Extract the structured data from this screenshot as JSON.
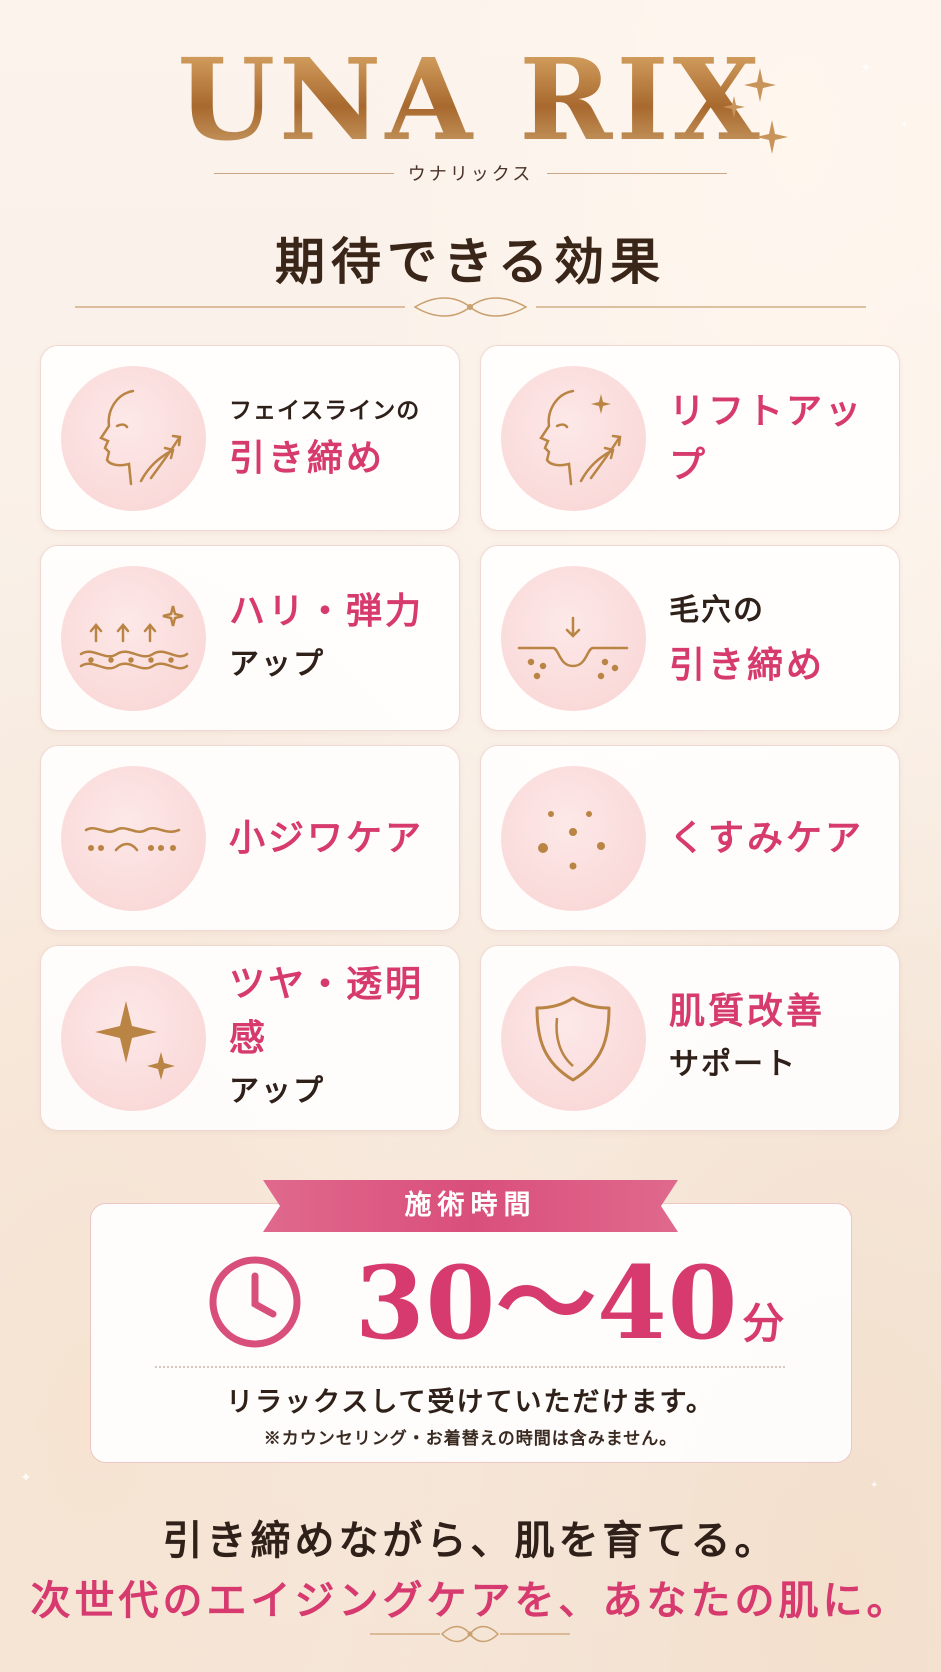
{
  "brand": {
    "logo": "UNA RIX",
    "kana": "ウナリックス"
  },
  "section_title": "期待できる効果",
  "effects": [
    {
      "icon": "face-lift-icon",
      "line1": "フェイスラインの",
      "line2": "引き締め"
    },
    {
      "icon": "face-sparkle-lift-icon",
      "line1": "リフトアップ"
    },
    {
      "icon": "skin-firming-icon",
      "line1": "ハリ・弾力",
      "line2": "アップ"
    },
    {
      "icon": "pore-tightening-icon",
      "line1": "毛穴の",
      "line2": "引き締め"
    },
    {
      "icon": "fine-wrinkle-icon",
      "line1": "小ジワケア"
    },
    {
      "icon": "dullness-dots-icon",
      "line1": "くすみケア"
    },
    {
      "icon": "sparkle-icon",
      "line1": "ツヤ・透明感",
      "line2": "アップ"
    },
    {
      "icon": "shield-icon",
      "line1": "肌質改善",
      "line2": "サポート"
    }
  ],
  "treatment": {
    "label": "施術時間",
    "value": "30〜40",
    "unit": "分",
    "relax_text": "リラックスして受けていただけます。",
    "note": "※カウンセリング・お着替えの時間は含みません。"
  },
  "tagline": {
    "line1": "引き締めながら、肌を育てる。",
    "line2": "次世代のエイジングケアを、あなたの肌に。"
  },
  "colors": {
    "gold": "#c08a4a",
    "pink": "#d63a6e",
    "dark": "#2f2019",
    "icon_bg": "#f8d4d3"
  }
}
